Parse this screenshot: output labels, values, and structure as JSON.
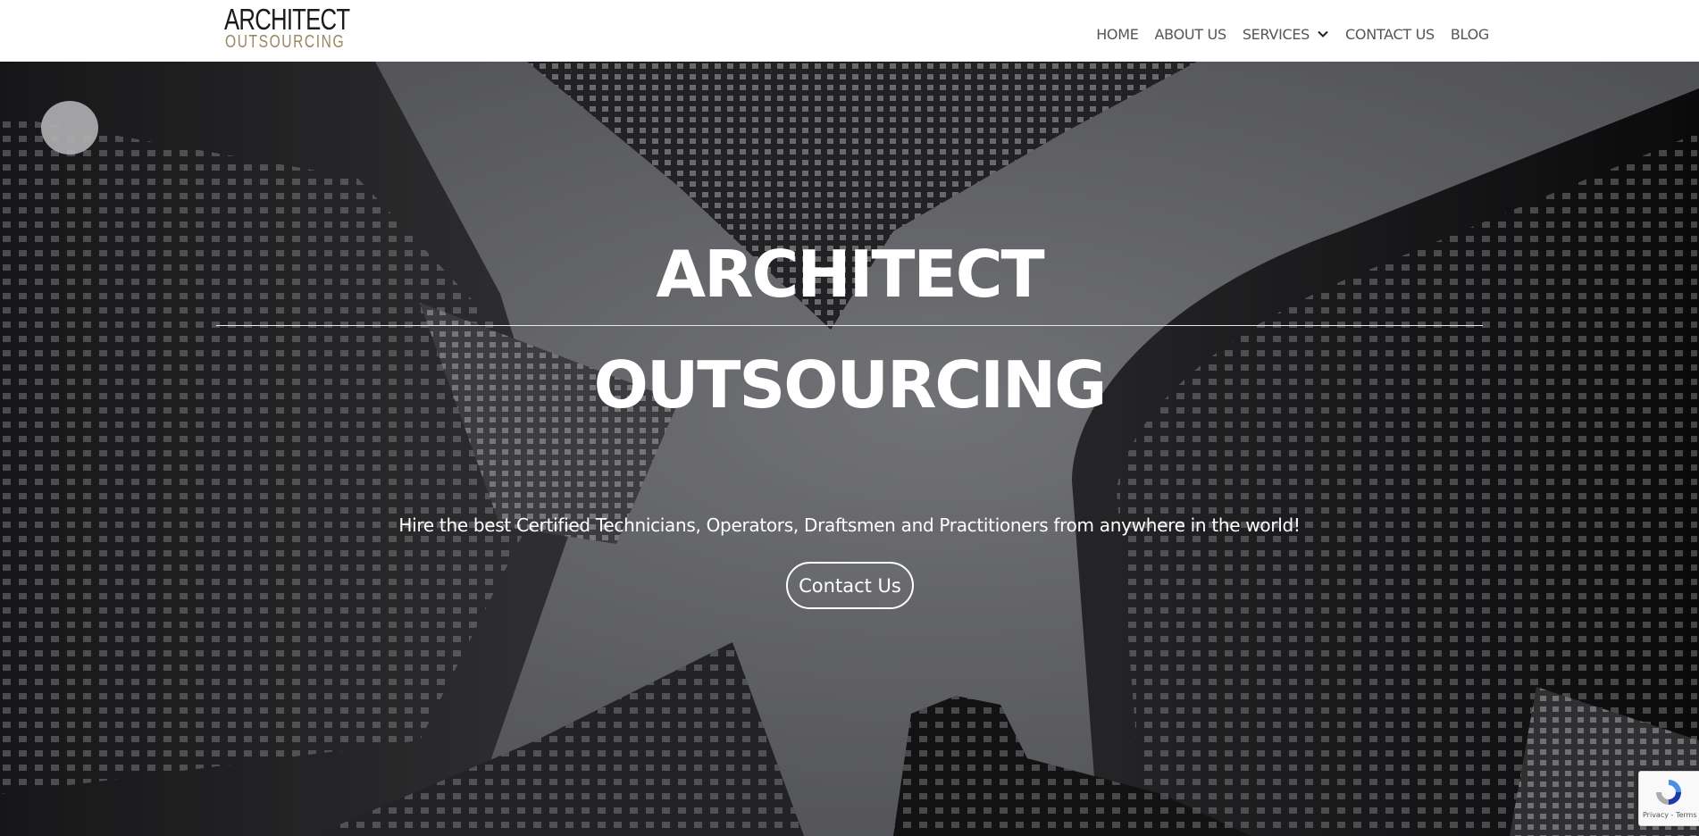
{
  "logo": {
    "top": "ARCHITECT",
    "bottom": "OUTSOURCING"
  },
  "nav": {
    "items": [
      {
        "label": "HOME"
      },
      {
        "label": "ABOUT US"
      },
      {
        "label": "SERVICES",
        "has_dropdown": true,
        "icon": "chevron-down-icon"
      },
      {
        "label": "CONTACT US"
      },
      {
        "label": "BLOG"
      }
    ]
  },
  "hero": {
    "title_line1": "ARCHITECT",
    "title_line2": "OUTSOURCING",
    "subtitle": "Hire the best Certified Technicians, Operators, Draftsmen and Practitioners from anywhere in the world!",
    "button_label": "Contact Us",
    "background": "grayscale photo of skyscrapers viewed from below"
  },
  "recaptcha": {
    "icon": "recaptcha-icon",
    "text": "Privacy - Terms"
  },
  "colors": {
    "header_bg": "#ffffff",
    "nav_text": "#555555",
    "logo_dark": "#1a1a1a",
    "logo_gold": "#9a8760",
    "hero_text": "#ffffff"
  }
}
